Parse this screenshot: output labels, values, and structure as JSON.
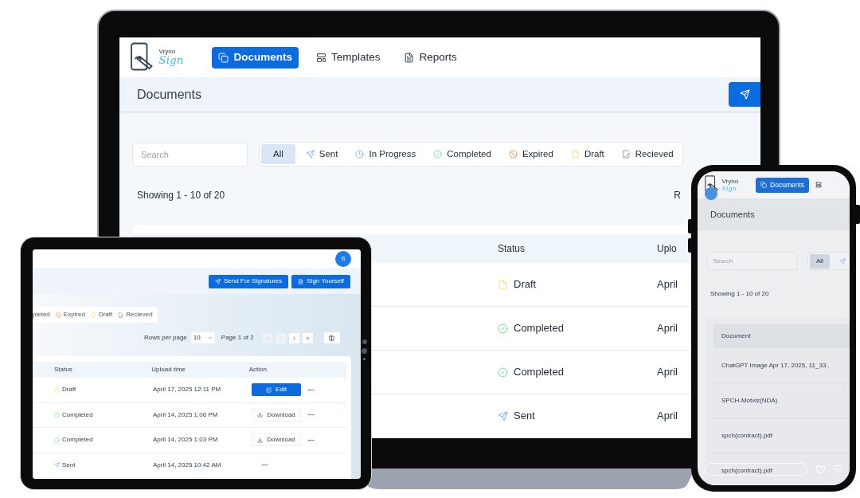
{
  "laptop": {
    "logo": {
      "brand": "Vryno",
      "script": "Sign"
    },
    "nav": [
      {
        "label": "Documents",
        "selected": true
      },
      {
        "label": "Templates",
        "selected": false
      },
      {
        "label": "Reports",
        "selected": false
      }
    ],
    "page_title": "Documents",
    "search": {
      "placeholder": "Search"
    },
    "filters": [
      {
        "label": "All",
        "kind": "all",
        "selected": true
      },
      {
        "label": "Sent",
        "kind": "sent",
        "selected": false
      },
      {
        "label": "In Progress",
        "kind": "progress",
        "selected": false
      },
      {
        "label": "Completed",
        "kind": "completed",
        "selected": false
      },
      {
        "label": "Expired",
        "kind": "expired",
        "selected": false
      },
      {
        "label": "Draft",
        "kind": "draft",
        "selected": false
      },
      {
        "label": "Recieved",
        "kind": "received",
        "selected": false
      }
    ],
    "showing": "Showing 1 - 10 of 20",
    "right_label": "R",
    "table": {
      "columns": [
        "Status",
        "Uplo"
      ],
      "rows": [
        {
          "status": "Draft",
          "kind": "draft",
          "upload": "April"
        },
        {
          "status": "Completed",
          "kind": "completed",
          "upload": "April"
        },
        {
          "status": "Completed",
          "kind": "completed",
          "upload": "April"
        },
        {
          "status": "Sent",
          "kind": "sent",
          "upload": "April"
        }
      ]
    }
  },
  "tablet": {
    "avatar": "S",
    "buttons": [
      {
        "label": "Send For Signatures"
      },
      {
        "label": "Sign Yourself"
      }
    ],
    "filters": [
      {
        "label": "pleted",
        "kind": "none",
        "selected": false
      },
      {
        "label": "Expired",
        "kind": "expired",
        "selected": false
      },
      {
        "label": "Draft",
        "kind": "draft",
        "selected": false
      },
      {
        "label": "Recieved",
        "kind": "received",
        "selected": false
      }
    ],
    "rows_per_page": {
      "label": "Rows per page",
      "value": "10"
    },
    "page": "Page 1 of 2",
    "pager": [
      {
        "kind": "first",
        "disabled": true
      },
      {
        "kind": "prev",
        "disabled": true
      },
      {
        "kind": "next",
        "disabled": false
      },
      {
        "kind": "last",
        "disabled": false
      }
    ],
    "table": {
      "columns": [
        "Status",
        "Upload time",
        "Action"
      ],
      "rows": [
        {
          "status": "Draft",
          "kind": "draft",
          "upload": "April 17, 2025 12:11 PM",
          "action": {
            "kind": "edit",
            "label": "Edit"
          }
        },
        {
          "status": "Completed",
          "kind": "completed",
          "upload": "April 14, 2025 1:06 PM",
          "action": {
            "kind": "download",
            "label": "Download"
          }
        },
        {
          "status": "Completed",
          "kind": "completed",
          "upload": "April 14, 2025 1:03 PM",
          "action": {
            "kind": "download",
            "label": "Download"
          }
        },
        {
          "status": "Sent",
          "kind": "sent",
          "upload": "April 14, 2025 10:42 AM"
        }
      ]
    }
  },
  "phone": {
    "logo": {
      "brand": "Vryno",
      "script": "Sign"
    },
    "nav": [
      {
        "label": "Documents",
        "selected": true
      },
      {
        "selected": false
      }
    ],
    "page_title": "Documents",
    "search": {
      "placeholder": "Search"
    },
    "filters": [
      {
        "label": "All",
        "kind": "all",
        "selected": true
      },
      {
        "kind": "sent",
        "selected": false
      }
    ],
    "showing": "Showing 1 - 10 of 20",
    "table": {
      "columns": [
        "Document"
      ],
      "rows": [
        {
          "document": "ChatGPT Image Apr 17, 2025, 11_33.."
        },
        {
          "document": "SPCH-Motviz(NDA)"
        },
        {
          "document": "spch(contract).pdf"
        },
        {
          "document": "spch(contract).pdf"
        }
      ]
    }
  }
}
